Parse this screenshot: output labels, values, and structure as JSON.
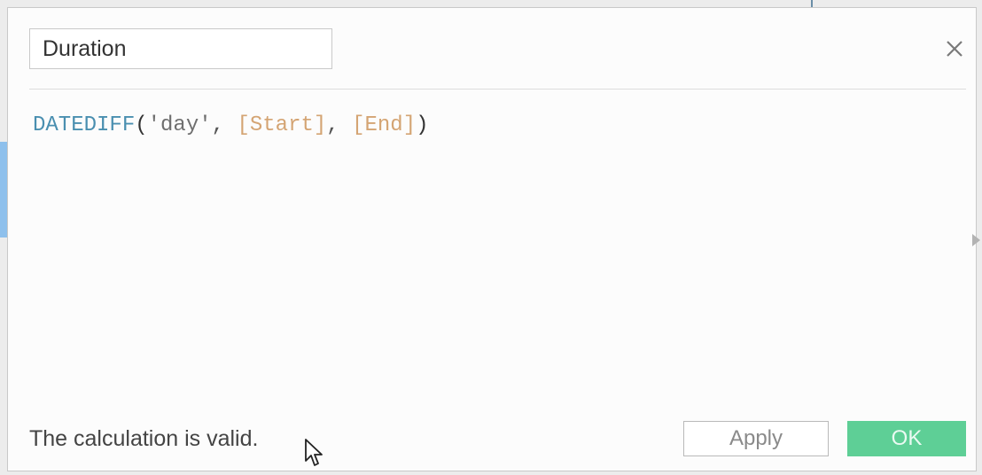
{
  "dialog": {
    "name_field": {
      "value": "Duration"
    },
    "close_icon": "close-x-icon",
    "formula": {
      "tokens": {
        "function": "DATEDIFF",
        "open_paren": "(",
        "string_arg": "'day'",
        "sep1": ", ",
        "field_start": "[Start]",
        "sep2": ", ",
        "field_end": "[End]",
        "close_paren": ")"
      }
    },
    "status": "The calculation is valid.",
    "buttons": {
      "apply": "Apply",
      "ok": "OK"
    }
  },
  "colors": {
    "function": "#4a8fb0",
    "field": "#d4a473",
    "ok_button": "#5ecf96",
    "selection_strip": "#8ec0ec"
  },
  "icons": {
    "close": "close-icon",
    "scroll": "chevron-right-icon",
    "cursor": "mouse-pointer-icon"
  }
}
